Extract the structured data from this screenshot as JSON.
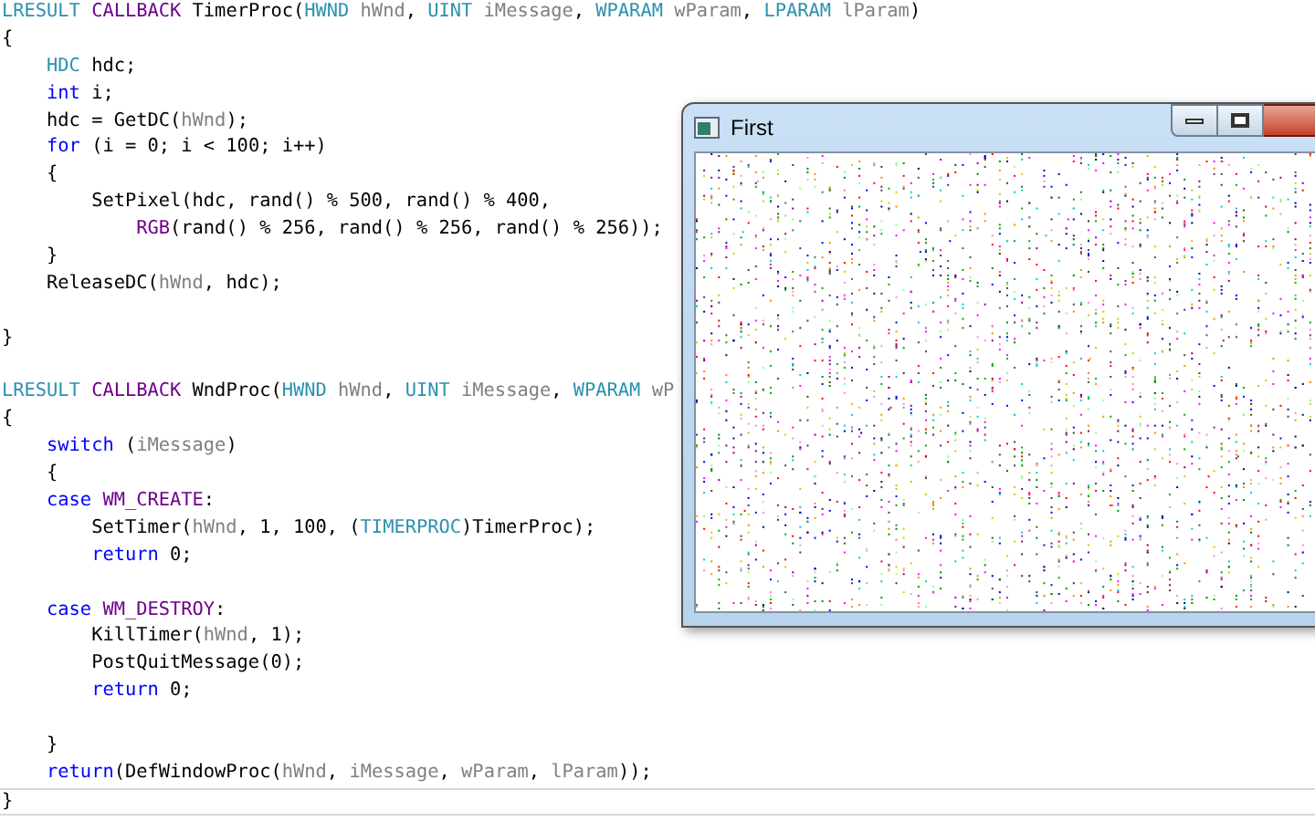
{
  "editor": {
    "lines": [
      {
        "current": false,
        "tokens": [
          {
            "kind": "type",
            "text": "LRESULT "
          },
          {
            "kind": "macro",
            "text": "CALLBACK"
          },
          {
            "kind": "plain",
            "text": " TimerProc("
          },
          {
            "kind": "type",
            "text": "HWND "
          },
          {
            "kind": "param",
            "text": "hWnd"
          },
          {
            "kind": "plain",
            "text": ", "
          },
          {
            "kind": "type",
            "text": "UINT "
          },
          {
            "kind": "param",
            "text": "iMessage"
          },
          {
            "kind": "plain",
            "text": ", "
          },
          {
            "kind": "type",
            "text": "WPARAM "
          },
          {
            "kind": "param",
            "text": "wParam"
          },
          {
            "kind": "plain",
            "text": ", "
          },
          {
            "kind": "type",
            "text": "LPARAM "
          },
          {
            "kind": "param",
            "text": "lParam"
          },
          {
            "kind": "plain",
            "text": ")"
          }
        ]
      },
      {
        "current": false,
        "tokens": [
          {
            "kind": "plain",
            "text": "{"
          }
        ]
      },
      {
        "current": false,
        "tokens": [
          {
            "kind": "type",
            "text": "    HDC"
          },
          {
            "kind": "plain",
            "text": " hdc;"
          }
        ]
      },
      {
        "current": false,
        "tokens": [
          {
            "kind": "keyword",
            "text": "    int"
          },
          {
            "kind": "plain",
            "text": " i;"
          }
        ]
      },
      {
        "current": false,
        "tokens": [
          {
            "kind": "plain",
            "text": "    hdc = GetDC("
          },
          {
            "kind": "param",
            "text": "hWnd"
          },
          {
            "kind": "plain",
            "text": ");"
          }
        ]
      },
      {
        "current": false,
        "tokens": [
          {
            "kind": "keyword",
            "text": "    for"
          },
          {
            "kind": "plain",
            "text": " (i = 0; i < 100; i++)"
          }
        ]
      },
      {
        "current": false,
        "tokens": [
          {
            "kind": "plain",
            "text": "    {"
          }
        ]
      },
      {
        "current": false,
        "tokens": [
          {
            "kind": "plain",
            "text": "        SetPixel(hdc, rand() % 500, rand() % 400,"
          }
        ]
      },
      {
        "current": false,
        "tokens": [
          {
            "kind": "macro",
            "text": "            RGB"
          },
          {
            "kind": "plain",
            "text": "(rand() % 256, rand() % 256, rand() % 256));"
          }
        ]
      },
      {
        "current": false,
        "tokens": [
          {
            "kind": "plain",
            "text": "    }"
          }
        ]
      },
      {
        "current": false,
        "tokens": [
          {
            "kind": "plain",
            "text": "    ReleaseDC("
          },
          {
            "kind": "param",
            "text": "hWnd"
          },
          {
            "kind": "plain",
            "text": ", hdc);"
          }
        ]
      },
      {
        "current": false
      },
      {
        "current": false,
        "tokens": [
          {
            "kind": "plain",
            "text": "}"
          }
        ]
      },
      {
        "current": false
      },
      {
        "current": false,
        "tokens": [
          {
            "kind": "type",
            "text": "LRESULT "
          },
          {
            "kind": "macro",
            "text": "CALLBACK"
          },
          {
            "kind": "plain",
            "text": " WndProc("
          },
          {
            "kind": "type",
            "text": "HWND "
          },
          {
            "kind": "param",
            "text": "hWnd"
          },
          {
            "kind": "plain",
            "text": ", "
          },
          {
            "kind": "type",
            "text": "UINT "
          },
          {
            "kind": "param",
            "text": "iMessage"
          },
          {
            "kind": "plain",
            "text": ", "
          },
          {
            "kind": "type",
            "text": "WPARAM "
          },
          {
            "kind": "param",
            "text": "wP"
          }
        ]
      },
      {
        "current": false,
        "tokens": [
          {
            "kind": "plain",
            "text": "{"
          }
        ]
      },
      {
        "current": false,
        "tokens": [
          {
            "kind": "keyword",
            "text": "    switch"
          },
          {
            "kind": "plain",
            "text": " ("
          },
          {
            "kind": "param",
            "text": "iMessage"
          },
          {
            "kind": "plain",
            "text": ")"
          }
        ]
      },
      {
        "current": false,
        "tokens": [
          {
            "kind": "plain",
            "text": "    {"
          }
        ]
      },
      {
        "current": false,
        "tokens": [
          {
            "kind": "keyword",
            "text": "    case "
          },
          {
            "kind": "macro",
            "text": "WM_CREATE"
          },
          {
            "kind": "plain",
            "text": ":"
          }
        ]
      },
      {
        "current": false,
        "tokens": [
          {
            "kind": "plain",
            "text": "        SetTimer("
          },
          {
            "kind": "param",
            "text": "hWnd"
          },
          {
            "kind": "plain",
            "text": ", 1, 100, ("
          },
          {
            "kind": "type",
            "text": "TIMERPROC"
          },
          {
            "kind": "plain",
            "text": ")TimerProc);"
          }
        ]
      },
      {
        "current": false,
        "tokens": [
          {
            "kind": "keyword",
            "text": "        return"
          },
          {
            "kind": "plain",
            "text": " 0;"
          }
        ]
      },
      {
        "current": false
      },
      {
        "current": false,
        "tokens": [
          {
            "kind": "keyword",
            "text": "    case "
          },
          {
            "kind": "macro",
            "text": "WM_DESTROY"
          },
          {
            "kind": "plain",
            "text": ":"
          }
        ]
      },
      {
        "current": false,
        "tokens": [
          {
            "kind": "plain",
            "text": "        KillTimer("
          },
          {
            "kind": "param",
            "text": "hWnd"
          },
          {
            "kind": "plain",
            "text": ", 1);"
          }
        ]
      },
      {
        "current": false,
        "tokens": [
          {
            "kind": "plain",
            "text": "        PostQuitMessage(0);"
          }
        ]
      },
      {
        "current": false,
        "tokens": [
          {
            "kind": "keyword",
            "text": "        return"
          },
          {
            "kind": "plain",
            "text": " 0;"
          }
        ]
      },
      {
        "current": false
      },
      {
        "current": false,
        "tokens": [
          {
            "kind": "plain",
            "text": "    }"
          }
        ]
      },
      {
        "current": false,
        "tokens": [
          {
            "kind": "keyword",
            "text": "    return"
          },
          {
            "kind": "plain",
            "text": "(DefWindowProc("
          },
          {
            "kind": "param",
            "text": "hWnd"
          },
          {
            "kind": "plain",
            "text": ", "
          },
          {
            "kind": "param",
            "text": "iMessage"
          },
          {
            "kind": "plain",
            "text": ", "
          },
          {
            "kind": "param",
            "text": "wParam"
          },
          {
            "kind": "plain",
            "text": ", "
          },
          {
            "kind": "param",
            "text": "lParam"
          },
          {
            "kind": "plain",
            "text": "));"
          }
        ]
      },
      {
        "current": true,
        "tokens": [
          {
            "kind": "plain",
            "text": "}"
          }
        ]
      }
    ]
  },
  "window": {
    "title": "First"
  }
}
